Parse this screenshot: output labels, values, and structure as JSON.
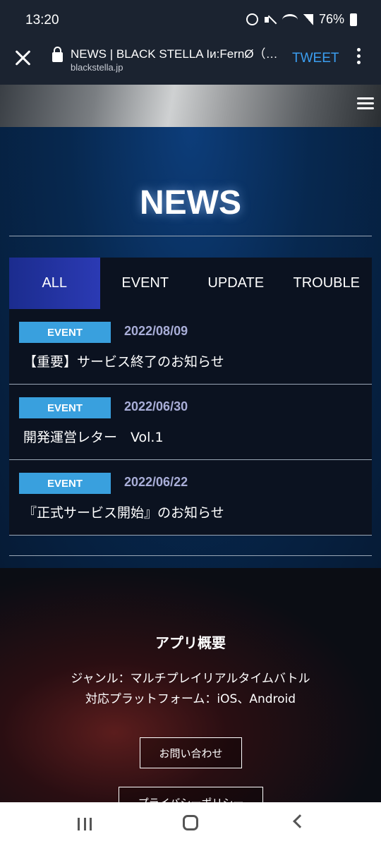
{
  "status": {
    "time": "13:20",
    "battery": "76%"
  },
  "browser": {
    "title": "NEWS | BLACK STELLA Iи:FernØ（ブ…",
    "url": "blackstella.jp",
    "action": "TWEET"
  },
  "news": {
    "heading": "NEWS",
    "tabs": [
      "ALL",
      "EVENT",
      "UPDATE",
      "TROUBLE"
    ],
    "active_tab": "ALL",
    "items": [
      {
        "category": "EVENT",
        "date": "2022/08/09",
        "title": "【重要】サービス終了のお知らせ"
      },
      {
        "category": "EVENT",
        "date": "2022/06/30",
        "title": "開発運営レター　Vol.1"
      },
      {
        "category": "EVENT",
        "date": "2022/06/22",
        "title": "『正式サービス開始』のお知らせ"
      }
    ]
  },
  "about": {
    "title": "アプリ概要",
    "genre": "ジャンル：マルチプレイリアルタイムバトル",
    "platform": "対応プラットフォーム：iOS、Android",
    "contact_button": "お問い合わせ",
    "privacy_button": "プライバシーポリシー"
  },
  "colors": {
    "tab_active": "#2b3ab4",
    "badge": "#39a0de",
    "date": "#a9aed8",
    "tweet": "#3b9ef0"
  }
}
